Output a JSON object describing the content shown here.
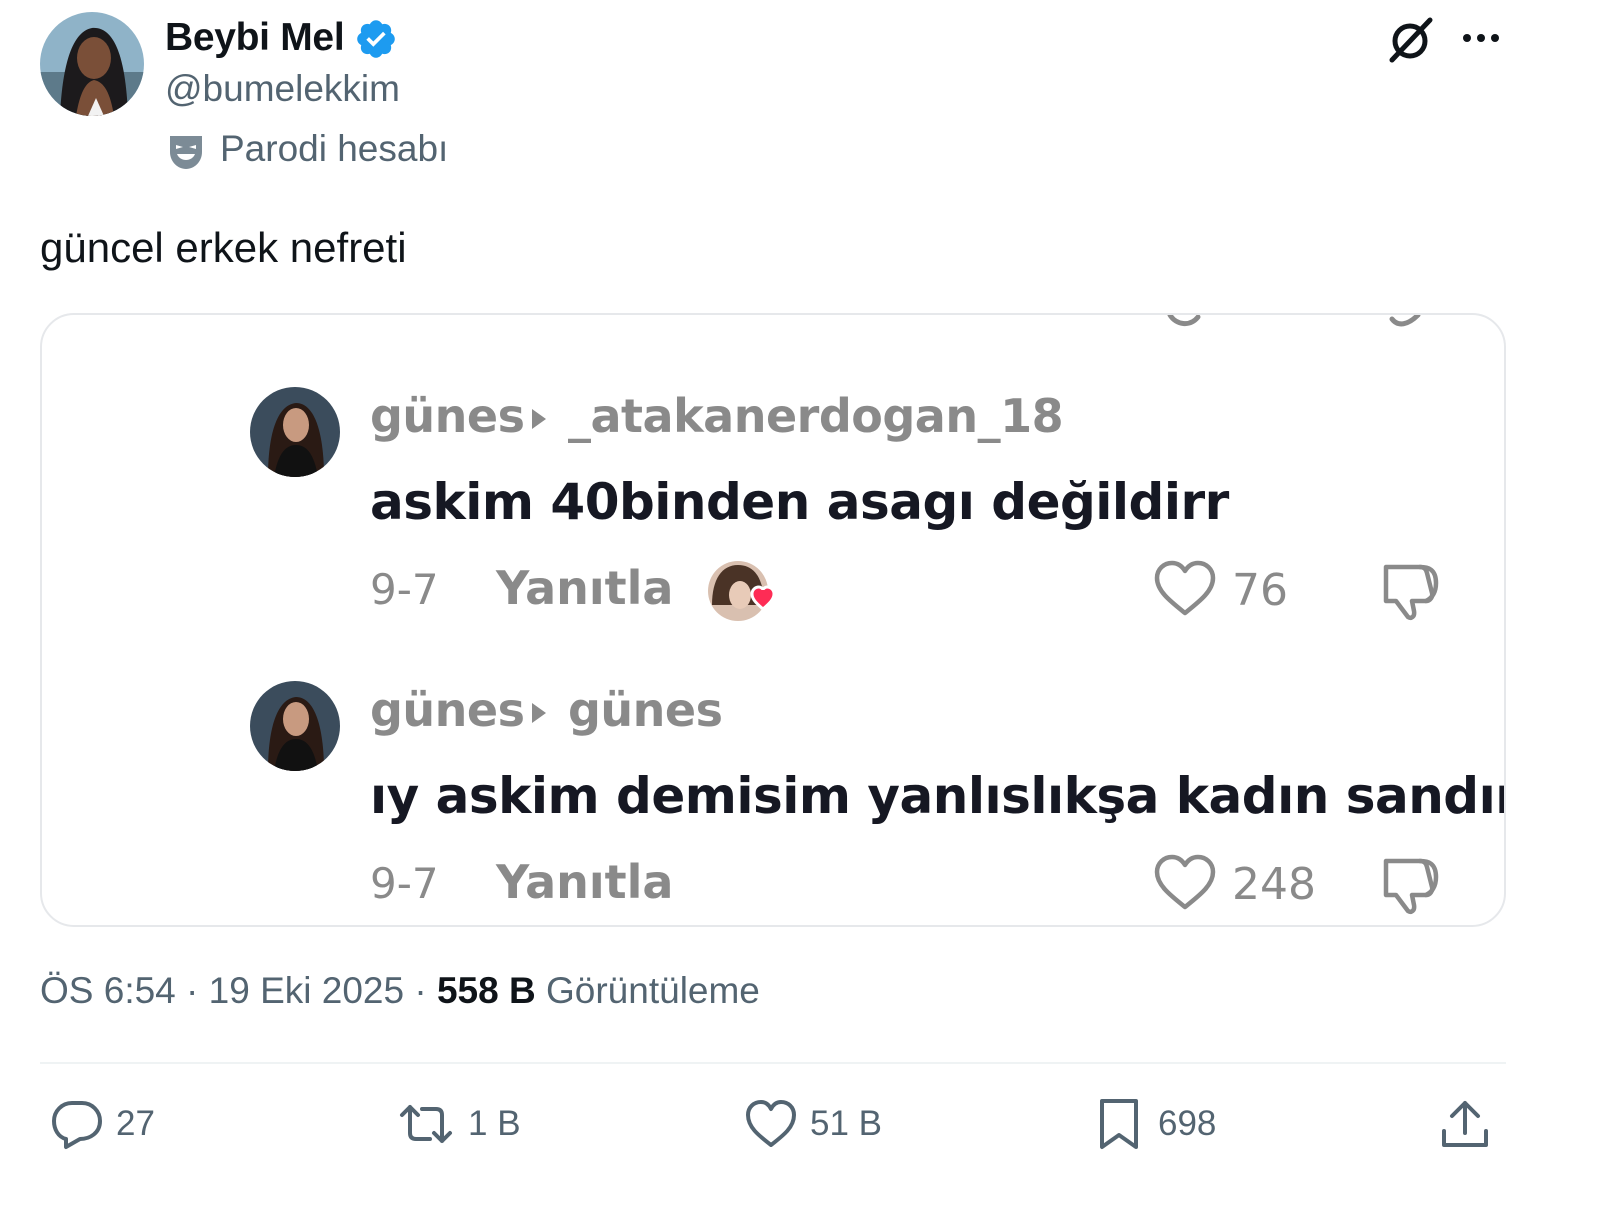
{
  "author": {
    "display_name": "Beybi Mel",
    "handle": "@bumelekkim",
    "label": "Parodi hesabı"
  },
  "tweet": {
    "text": "güncel erkek nefreti"
  },
  "comments": [
    {
      "user": "günes",
      "reply_to": "_atakanerdogan_18",
      "text": "askim 40binden asagı değildirr",
      "date": "9-7",
      "reply_label": "Yanıtla",
      "likes": "76"
    },
    {
      "user": "günes",
      "reply_to": "günes",
      "text": "ıy askim demisim yanlıslıkşa kadın sandım",
      "date": "9-7",
      "reply_label": "Yanıtla",
      "likes": "248"
    }
  ],
  "meta": {
    "time": "ÖS 6:54",
    "date": "19 Eki 2025",
    "views": "558 B",
    "views_label": "Görüntüleme"
  },
  "actions": {
    "replies": "27",
    "reposts": "1 B",
    "likes": "51 B",
    "bookmarks": "698"
  },
  "icons": [
    "verified-badge-icon",
    "parody-mask-icon",
    "grok-icon",
    "more-icon",
    "play-arrow-icon",
    "heart-icon",
    "dislike-icon",
    "reply-icon",
    "repost-icon",
    "like-icon",
    "bookmark-icon",
    "share-icon"
  ],
  "colors": {
    "verified": "#1d9bf0",
    "secondary_text": "#536471",
    "comment_gray": "#8a8a8a",
    "liker_heart": "#fe2c55"
  }
}
